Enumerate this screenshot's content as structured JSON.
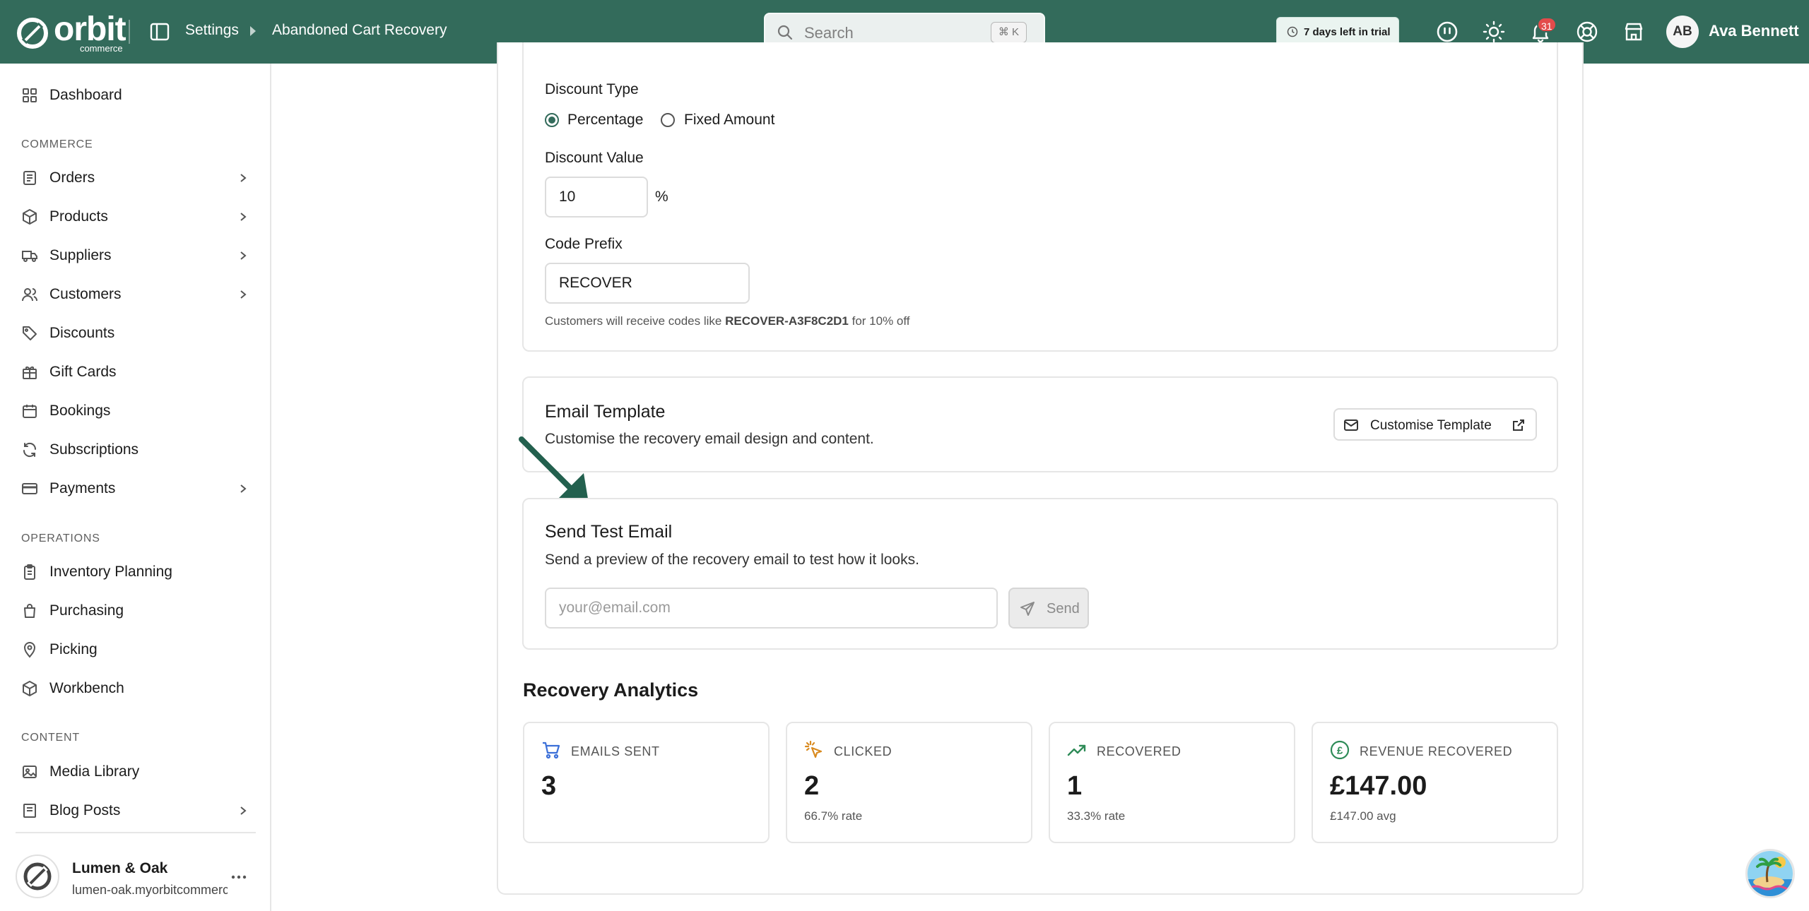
{
  "header": {
    "logo_word": "orbit",
    "logo_sub": "commerce",
    "breadcrumb": [
      "Settings",
      "Abandoned Cart Recovery"
    ],
    "search_placeholder": "Search",
    "search_shortcut": "⌘ K",
    "trial_label": "7 days left in trial",
    "notification_count": "31",
    "user_initials": "AB",
    "user_name": "Ava Bennett",
    "brand_color": "#336b5b"
  },
  "sidebar": {
    "dashboard": "Dashboard",
    "section_commerce": "COMMERCE",
    "commerce_items": [
      "Orders",
      "Products",
      "Suppliers",
      "Customers",
      "Discounts",
      "Gift Cards",
      "Bookings",
      "Subscriptions",
      "Payments"
    ],
    "section_operations": "OPERATIONS",
    "operations_items": [
      "Inventory Planning",
      "Purchasing",
      "Picking",
      "Workbench"
    ],
    "section_content": "CONTENT",
    "content_items": [
      "Media Library",
      "Blog Posts"
    ],
    "store_name": "Lumen & Oak",
    "store_url": "lumen-oak.myorbitcommerce.com"
  },
  "discount": {
    "type_label": "Discount Type",
    "option_percentage": "Percentage",
    "option_fixed": "Fixed Amount",
    "selected": "Percentage",
    "value_label": "Discount Value",
    "value": "10",
    "value_suffix": "%",
    "prefix_label": "Code Prefix",
    "prefix_value": "RECOVER",
    "hint_pre": "Customers will receive codes like",
    "hint_code": "RECOVER-A3F8C2D1",
    "hint_post": "for 10% off"
  },
  "email_template": {
    "title": "Email Template",
    "description": "Customise the recovery email design and content.",
    "button_label": "Customise Template"
  },
  "test_email": {
    "title": "Send Test Email",
    "description": "Send a preview of the recovery email to test how it looks.",
    "input_placeholder": "your@email.com",
    "button_label": "Send"
  },
  "analytics": {
    "heading": "Recovery Analytics",
    "stats": [
      {
        "label": "EMAILS SENT",
        "value": "3",
        "sub": "",
        "icon": "cart-icon",
        "color": "#3b6fd8"
      },
      {
        "label": "CLICKED",
        "value": "2",
        "sub": "66.7% rate",
        "icon": "pointer-click-icon",
        "color": "#d98a1f"
      },
      {
        "label": "RECOVERED",
        "value": "1",
        "sub": "33.3% rate",
        "icon": "trending-up-icon",
        "color": "#2e8b57"
      },
      {
        "label": "REVENUE RECOVERED",
        "value": "£147.00",
        "sub": "£147.00 avg",
        "icon": "pound-coin-icon",
        "color": "#2e8b57"
      }
    ]
  }
}
